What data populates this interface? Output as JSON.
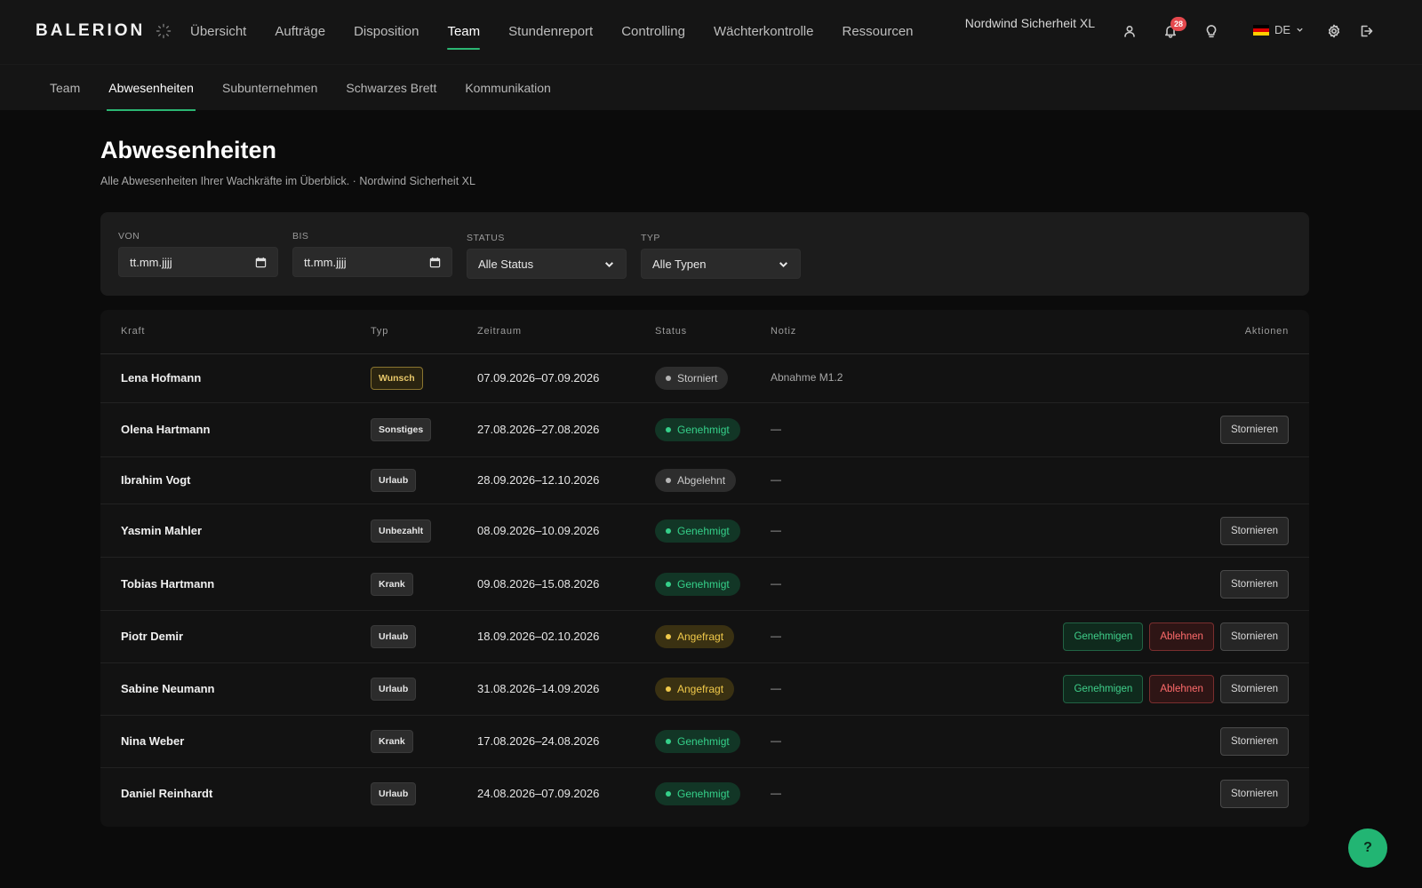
{
  "brand": {
    "name": "BALERION"
  },
  "main_nav": {
    "items": [
      {
        "label": "Übersicht",
        "active": false
      },
      {
        "label": "Aufträge",
        "active": false
      },
      {
        "label": "Disposition",
        "active": false
      },
      {
        "label": "Team",
        "active": true
      },
      {
        "label": "Stundenreport",
        "active": false
      },
      {
        "label": "Controlling",
        "active": false
      },
      {
        "label": "Wächterkontrolle",
        "active": false
      },
      {
        "label": "Ressourcen",
        "active": false
      }
    ]
  },
  "header": {
    "company": "Nordwind Sicherheit XL",
    "notification_count": "28",
    "language": "DE",
    "icons": [
      "user-icon",
      "bell-icon",
      "lightbulb-icon",
      "chevron-down-icon",
      "gear-icon",
      "logout-icon"
    ]
  },
  "sub_nav": {
    "items": [
      {
        "label": "Team",
        "active": false
      },
      {
        "label": "Abwesenheiten",
        "active": true
      },
      {
        "label": "Subunternehmen",
        "active": false
      },
      {
        "label": "Schwarzes Brett",
        "active": false
      },
      {
        "label": "Kommunikation",
        "active": false
      }
    ]
  },
  "page": {
    "title": "Abwesenheiten",
    "subtitle": "Alle Abwesenheiten Ihrer Wachkräfte im Überblick. · Nordwind Sicherheit XL"
  },
  "filters": {
    "von": {
      "label": "VON",
      "value": "tt.mm.jjjj"
    },
    "bis": {
      "label": "BIS",
      "value": "tt.mm.jjjj"
    },
    "status": {
      "label": "STATUS",
      "value": "Alle Status"
    },
    "typ": {
      "label": "TYP",
      "value": "Alle Typen"
    }
  },
  "table": {
    "headers": {
      "kraft": "Kraft",
      "typ": "Typ",
      "zeitraum": "Zeitraum",
      "status": "Status",
      "notiz": "Notiz",
      "aktionen": "Aktionen"
    },
    "action_labels": {
      "approve": "Genehmigen",
      "reject": "Ablehnen",
      "cancel": "Stornieren"
    },
    "status_colors": {
      "green": "#35d08a",
      "grey": "#b5b5b5",
      "yellow": "#f0c94a"
    },
    "rows": [
      {
        "name": "Lena Hofmann",
        "type": "Wunsch",
        "type_style": "wish",
        "period": "07.09.2026–07.09.2026",
        "status": "Storniert",
        "status_style": "grey",
        "note": "Abnahme M1.2",
        "actions": []
      },
      {
        "name": "Olena Hartmann",
        "type": "Sonstiges",
        "type_style": "default",
        "period": "27.08.2026–27.08.2026",
        "status": "Genehmigt",
        "status_style": "green",
        "note": "—",
        "actions": [
          "cancel"
        ]
      },
      {
        "name": "Ibrahim Vogt",
        "type": "Urlaub",
        "type_style": "default",
        "period": "28.09.2026–12.10.2026",
        "status": "Abgelehnt",
        "status_style": "grey",
        "note": "—",
        "actions": []
      },
      {
        "name": "Yasmin Mahler",
        "type": "Unbezahlt",
        "type_style": "default",
        "period": "08.09.2026–10.09.2026",
        "status": "Genehmigt",
        "status_style": "green",
        "note": "—",
        "actions": [
          "cancel"
        ]
      },
      {
        "name": "Tobias Hartmann",
        "type": "Krank",
        "type_style": "default",
        "period": "09.08.2026–15.08.2026",
        "status": "Genehmigt",
        "status_style": "green",
        "note": "—",
        "actions": [
          "cancel"
        ]
      },
      {
        "name": "Piotr Demir",
        "type": "Urlaub",
        "type_style": "default",
        "period": "18.09.2026–02.10.2026",
        "status": "Angefragt",
        "status_style": "yellow",
        "note": "—",
        "actions": [
          "approve",
          "reject",
          "cancel"
        ]
      },
      {
        "name": "Sabine Neumann",
        "type": "Urlaub",
        "type_style": "default",
        "period": "31.08.2026–14.09.2026",
        "status": "Angefragt",
        "status_style": "yellow",
        "note": "—",
        "actions": [
          "approve",
          "reject",
          "cancel"
        ]
      },
      {
        "name": "Nina Weber",
        "type": "Krank",
        "type_style": "default",
        "period": "17.08.2026–24.08.2026",
        "status": "Genehmigt",
        "status_style": "green",
        "note": "—",
        "actions": [
          "cancel"
        ]
      },
      {
        "name": "Daniel Reinhardt",
        "type": "Urlaub",
        "type_style": "default",
        "period": "24.08.2026–07.09.2026",
        "status": "Genehmigt",
        "status_style": "green",
        "note": "—",
        "actions": [
          "cancel"
        ]
      }
    ]
  },
  "help": {
    "label": "?"
  },
  "colors": {
    "accent": "#2bb673",
    "background": "#0b0b0b",
    "surface": "#151515"
  }
}
